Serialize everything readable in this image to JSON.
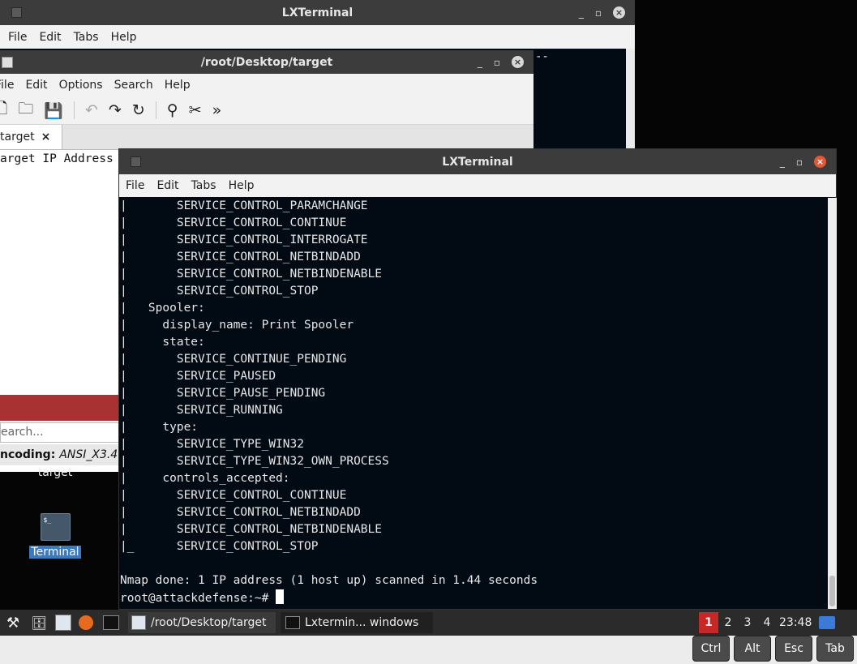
{
  "back_terminal": {
    "title": "LXTerminal",
    "menu": [
      "File",
      "Edit",
      "Tabs",
      "Help"
    ],
    "visible_text": "--"
  },
  "gedit": {
    "title": "/root/Desktop/target",
    "menu": [
      "File",
      "Edit",
      "Options",
      "Search",
      "Help"
    ],
    "tab_label": "target",
    "tab_close": "×",
    "content_line": "arget IP Address",
    "search_placeholder": "earch...",
    "encoding_label": "ncoding:",
    "encoding_value": "ANSI_X3.4"
  },
  "desktop": {
    "icon_target_label": "target",
    "icon_terminal_label": "Terminal",
    "icon_terminal_glyph": "$_"
  },
  "front_terminal": {
    "title": "LXTerminal",
    "menu": [
      "File",
      "Edit",
      "Tabs",
      "Help"
    ],
    "lines": [
      "|       SERVICE_CONTROL_PARAMCHANGE",
      "|       SERVICE_CONTROL_CONTINUE",
      "|       SERVICE_CONTROL_INTERROGATE",
      "|       SERVICE_CONTROL_NETBINDADD",
      "|       SERVICE_CONTROL_NETBINDENABLE",
      "|       SERVICE_CONTROL_STOP",
      "|   Spooler:",
      "|     display_name: Print Spooler",
      "|     state:",
      "|       SERVICE_CONTINUE_PENDING",
      "|       SERVICE_PAUSED",
      "|       SERVICE_PAUSE_PENDING",
      "|       SERVICE_RUNNING",
      "|     type:",
      "|       SERVICE_TYPE_WIN32",
      "|       SERVICE_TYPE_WIN32_OWN_PROCESS",
      "|     controls_accepted:",
      "|       SERVICE_CONTROL_CONTINUE",
      "|       SERVICE_CONTROL_NETBINDADD",
      "|       SERVICE_CONTROL_NETBINDENABLE",
      "|_      SERVICE_CONTROL_STOP",
      "",
      "Nmap done: 1 IP address (1 host up) scanned in 1.44 seconds"
    ],
    "prompt": "root@attackdefense:~# "
  },
  "taskbar": {
    "task_gedit": "/root/Desktop/target",
    "task_terminal": "Lxtermin... windows",
    "workspaces": [
      "1",
      "2",
      "3",
      "4"
    ],
    "active_workspace": "1",
    "clock": "23:48"
  },
  "keys": [
    "Ctrl",
    "Alt",
    "Esc",
    "Tab"
  ],
  "colors": {
    "terminal_bg": "#020a14",
    "workspace_active": "#c62828",
    "gedit_statusbar": "#a83232"
  }
}
